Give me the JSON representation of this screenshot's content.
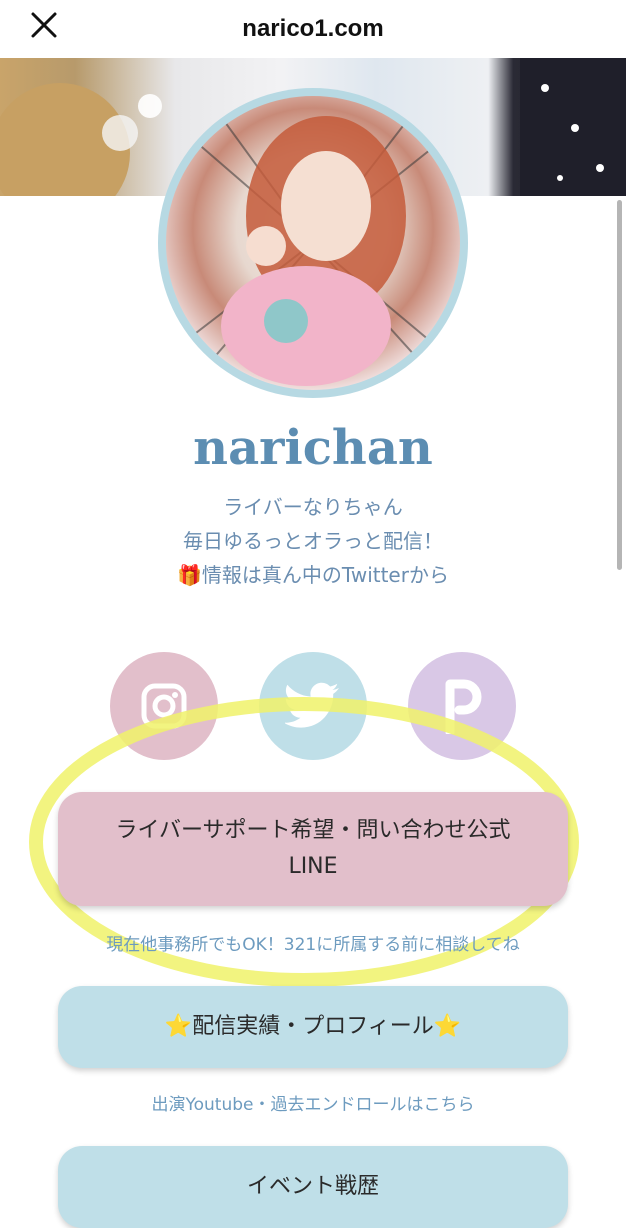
{
  "header": {
    "title": "narico1.com",
    "close_icon": "close-icon"
  },
  "profile": {
    "name": "narichan",
    "bio": [
      "ライバーなりちゃん",
      "毎日ゆるっとオラっと配信！",
      "🎁情報は真ん中のTwitterから"
    ]
  },
  "socials": [
    {
      "name": "instagram",
      "icon": "instagram-icon",
      "color": "#e2bfcb"
    },
    {
      "name": "twitter",
      "icon": "twitter-icon",
      "color": "#bfdfe8"
    },
    {
      "name": "pococha",
      "icon": "pococha-icon",
      "color": "#d9c8e6"
    }
  ],
  "links": [
    {
      "label_line1": "ライバーサポート希望・問い合わせ公式",
      "label_line2": "LINE",
      "caption": "現在他事務所でもOK！321に所属する前に相談してね",
      "color": "#e2bfcb"
    },
    {
      "label": "⭐配信実績・プロフィール⭐",
      "caption": "出演Youtube・過去エンドロールはこちら",
      "color": "#bfdfe8"
    },
    {
      "label": "イベント戦歴",
      "color": "#bfdfe8"
    }
  ],
  "colors": {
    "accent": "#5c8db2",
    "highlight": "#f0f26a"
  }
}
